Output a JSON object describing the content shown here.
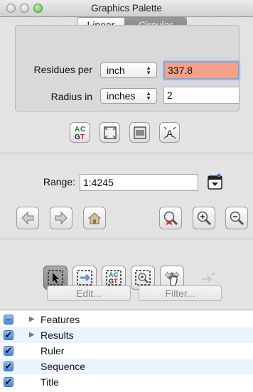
{
  "window": {
    "title": "Graphics Palette"
  },
  "view_mode": {
    "linear_label": "Linear",
    "circular_label": "Circular",
    "selected": "Circular"
  },
  "residues": {
    "label": "Residues per",
    "unit": "inch",
    "value": "337.8"
  },
  "radius": {
    "label": "Radius in",
    "unit": "inches",
    "value": "2"
  },
  "format_tools": [
    {
      "name": "sequence-letters-icon",
      "glyph": "AC/GT"
    },
    {
      "name": "fit-frame-icon"
    },
    {
      "name": "fit-width-icon"
    },
    {
      "name": "font-size-icon",
      "glyph": "A"
    }
  ],
  "range": {
    "label": "Range:",
    "value": "1:4245"
  },
  "nav_buttons": [
    {
      "name": "back-arrow-icon"
    },
    {
      "name": "forward-arrow-icon"
    },
    {
      "name": "home-icon"
    }
  ],
  "zoom_buttons": [
    {
      "name": "zoom-reset-icon"
    },
    {
      "name": "zoom-in-icon"
    },
    {
      "name": "zoom-out-icon"
    }
  ],
  "tools": {
    "selected": "select-arrow-tool",
    "disabled": [
      "pin-tool"
    ]
  },
  "actions": {
    "edit_label": "Edit...",
    "filter_label": "Filter..."
  },
  "layers": [
    {
      "label": "Features",
      "checked": "partial",
      "expandable": true
    },
    {
      "label": "Results",
      "checked": true,
      "expandable": true
    },
    {
      "label": "Ruler",
      "checked": true,
      "expandable": false
    },
    {
      "label": "Sequence",
      "checked": true,
      "expandable": false
    },
    {
      "label": "Title",
      "checked": true,
      "expandable": false
    }
  ],
  "colors": {
    "focused_field_bg": "#f3a188",
    "checkbox_blue": "#4b86d8",
    "selected_segment": "#8a8a8a"
  }
}
